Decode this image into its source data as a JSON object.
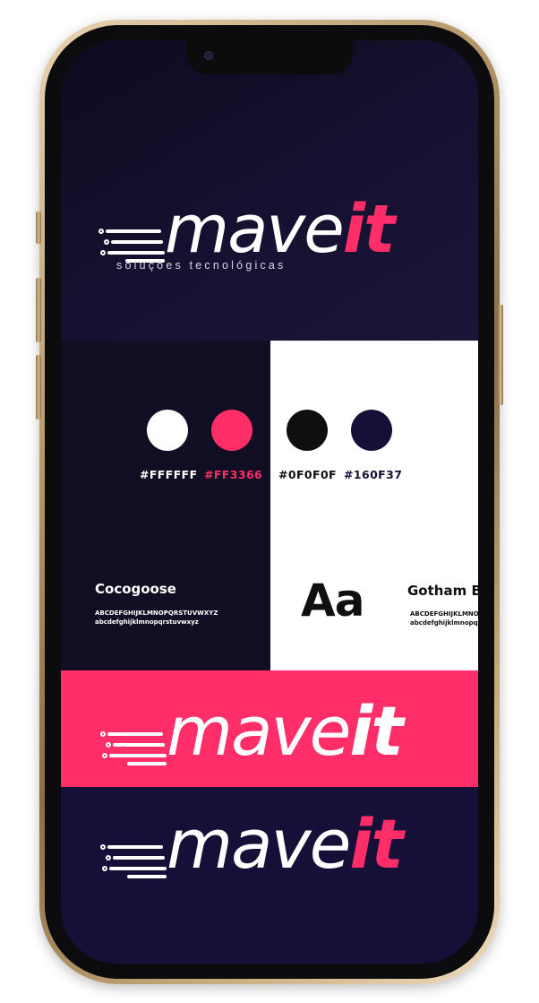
{
  "brand": {
    "logo_word": "mave",
    "logo_accent": "it",
    "tagline": "soluções tecnológicas"
  },
  "colors": {
    "white": "#FFFFFF",
    "pink": "#FF3366",
    "black": "#0F0F0F",
    "navy": "#160F37"
  },
  "palette": {
    "swatches": [
      {
        "label": "#FFFFFF",
        "color": "#FFFFFF"
      },
      {
        "label": "#FF3366",
        "color": "#FF3366"
      },
      {
        "label": "#0F0F0F",
        "color": "#0F0F0F"
      },
      {
        "label": "#160F37",
        "color": "#160F37"
      }
    ]
  },
  "typography": {
    "primary": {
      "name": "Cocogoose",
      "uppercase": "ABCDEFGHIJKLMNOPQRSTUVWXYZ",
      "lowercase": "abcdefghijklmnopqrstuvwxyz"
    },
    "sample": "Aa",
    "secondary": {
      "name": "Gotham B",
      "uppercase": "ABCDEFGHIJKLMNOPQRSTUVWXYZ",
      "lowercase": "abcdefghijklmnopqrstuvwxyz"
    }
  }
}
